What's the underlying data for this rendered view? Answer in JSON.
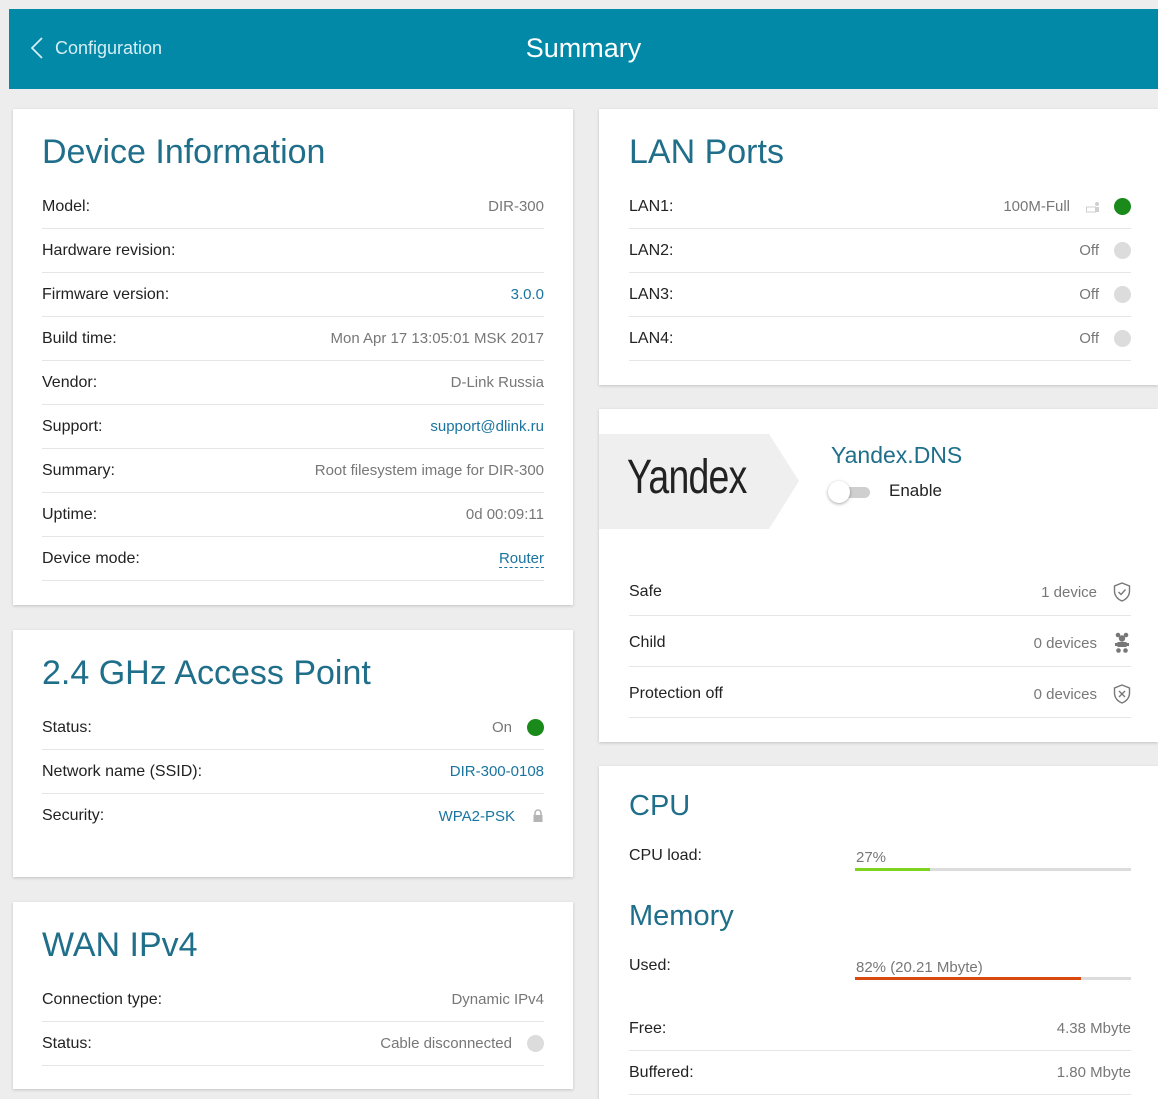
{
  "header": {
    "back_label": "Configuration",
    "title": "Summary"
  },
  "device_info": {
    "title": "Device Information",
    "rows": [
      {
        "label": "Model:",
        "value": "DIR-300"
      },
      {
        "label": "Hardware revision:",
        "value": ""
      },
      {
        "label": "Firmware version:",
        "value": "3.0.0"
      },
      {
        "label": "Build time:",
        "value": "Mon Apr 17 13:05:01 MSK 2017"
      },
      {
        "label": "Vendor:",
        "value": "D-Link Russia"
      },
      {
        "label": "Support:",
        "value": "support@dlink.ru"
      },
      {
        "label": "Summary:",
        "value": "Root filesystem image for DIR-300"
      },
      {
        "label": "Uptime:",
        "value": "0d 00:09:11"
      },
      {
        "label": "Device mode:",
        "value": "Router"
      }
    ]
  },
  "access_point": {
    "title": "2.4 GHz Access Point",
    "rows": [
      {
        "label": "Status:",
        "value": "On"
      },
      {
        "label": "Network name (SSID):",
        "value": "DIR-300-0108"
      },
      {
        "label": "Security:",
        "value": "WPA2-PSK"
      }
    ]
  },
  "wan": {
    "title": "WAN IPv4",
    "rows": [
      {
        "label": "Connection type:",
        "value": "Dynamic IPv4"
      },
      {
        "label": "Status:",
        "value": "Cable disconnected"
      }
    ]
  },
  "lan_ports": {
    "title": "LAN Ports",
    "ports": [
      {
        "label": "LAN1:",
        "value": "100M-Full",
        "active": true
      },
      {
        "label": "LAN2:",
        "value": "Off",
        "active": false
      },
      {
        "label": "LAN3:",
        "value": "Off",
        "active": false
      },
      {
        "label": "LAN4:",
        "value": "Off",
        "active": false
      }
    ]
  },
  "yandex": {
    "logo": "Yandex",
    "title": "Yandex.DNS",
    "toggle_label": "Enable",
    "enabled": false,
    "rows": [
      {
        "label": "Safe",
        "value": "1 device",
        "icon": "shield-check-icon"
      },
      {
        "label": "Child",
        "value": "0 devices",
        "icon": "child-icon"
      },
      {
        "label": "Protection off",
        "value": "0 devices",
        "icon": "shield-x-icon"
      }
    ]
  },
  "cpu": {
    "title": "CPU",
    "label": "CPU load:",
    "value_text": "27%",
    "percent": 27,
    "color": "#7ed321"
  },
  "memory": {
    "title": "Memory",
    "used_label": "Used:",
    "used_text": "82% (20.21 Mbyte)",
    "used_percent": 82,
    "color": "#d9480f",
    "free_label": "Free:",
    "free_value": "4.38 Mbyte",
    "buffered_label": "Buffered:",
    "buffered_value": "1.80 Mbyte"
  },
  "colors": {
    "header": "#0289a7",
    "title": "#1f6e8a",
    "link": "#1a74a0",
    "status_on": "#1a8a1a"
  }
}
